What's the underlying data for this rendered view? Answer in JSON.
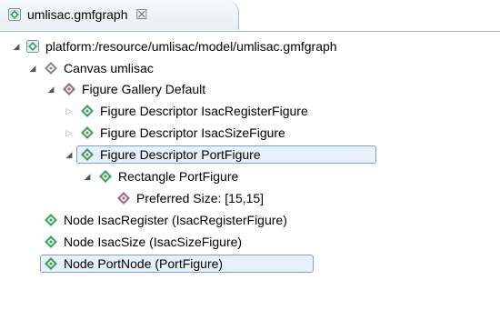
{
  "editor": {
    "tab_title": "umlisac.gmfgraph",
    "tab_close": "☒"
  },
  "tree": [
    {
      "label": "platform:/resource/umlisac/model/umlisac.gmfgraph",
      "icon": "gmfgraph-file-icon",
      "twisty": "expanded"
    },
    {
      "label": "Canvas umlisac",
      "icon": "canvas-icon",
      "twisty": "expanded"
    },
    {
      "label": "Figure Gallery Default",
      "icon": "figure-gallery-icon",
      "twisty": "expanded"
    },
    {
      "label": "Figure Descriptor IsacRegisterFigure",
      "icon": "figure-descriptor-icon",
      "twisty": "collapsed"
    },
    {
      "label": "Figure Descriptor IsacSizeFigure",
      "icon": "figure-descriptor-icon",
      "twisty": "collapsed"
    },
    {
      "label": "Figure Descriptor PortFigure",
      "icon": "figure-descriptor-icon",
      "twisty": "expanded",
      "selected": true
    },
    {
      "label": "Rectangle PortFigure",
      "icon": "rectangle-icon",
      "twisty": "expanded"
    },
    {
      "label": "Preferred Size: [15,15]",
      "icon": "preferred-size-icon",
      "twisty": "none"
    },
    {
      "label": "Node IsacRegister (IsacRegisterFigure)",
      "icon": "node-icon",
      "twisty": "none"
    },
    {
      "label": "Node IsacSize (IsacSizeFigure)",
      "icon": "node-icon",
      "twisty": "none"
    },
    {
      "label": "Node PortNode (PortFigure)",
      "icon": "node-icon",
      "twisty": "none",
      "selected": true
    }
  ],
  "colors": {
    "selection_fill": "#e8f1fb",
    "selection_border": "#7da2ce",
    "green_icon": "#3aa35a",
    "purple_icon": "#9b6a86"
  }
}
